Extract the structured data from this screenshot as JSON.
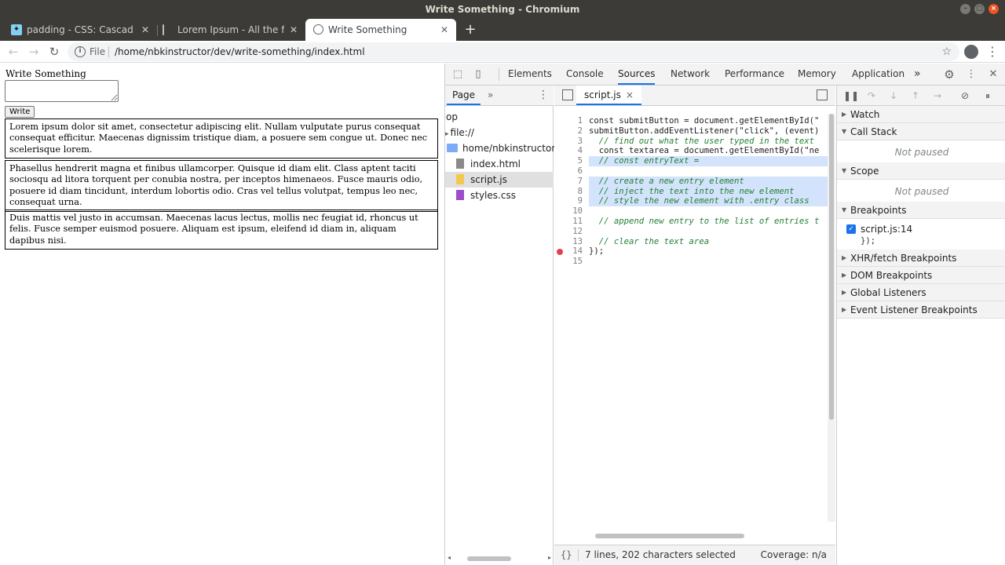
{
  "window": {
    "title": "Write Something - Chromium"
  },
  "tabs": [
    {
      "label": "padding - CSS: Cascading"
    },
    {
      "label": "Lorem Ipsum - All the fact"
    },
    {
      "label": "Write Something"
    }
  ],
  "toolbar": {
    "scheme": "File",
    "url": "/home/nbkinstructor/dev/write-something/index.html"
  },
  "page": {
    "heading": "Write Something",
    "write_button": "Write",
    "entries": [
      {
        "text": "Lorem ipsum dolor sit amet, consectetur adipiscing elit. Nullam vulputate purus consequat consequat efficitur. Maecenas dignissim tristique diam, a posuere sem congue ut. Donec nec scelerisque lorem."
      },
      {
        "text": "Phasellus hendrerit magna et finibus ullamcorper. Quisque id diam elit. Class aptent taciti sociosqu ad litora torquent per conubia nostra, per inceptos himenaeos. Fusce mauris odio, posuere id diam tincidunt, interdum lobortis odio. Cras vel tellus volutpat, tempus leo nec, consequat urna."
      },
      {
        "text": "Duis mattis vel justo in accumsan. Maecenas lacus lectus, mollis nec feugiat id, rhoncus ut felis. Fusce semper euismod posuere. Aliquam est ipsum, eleifend id diam in, aliquam dapibus nisi."
      }
    ]
  },
  "devtools": {
    "tabs": [
      {
        "label": "Elements"
      },
      {
        "label": "Console"
      },
      {
        "label": "Sources"
      },
      {
        "label": "Network"
      },
      {
        "label": "Performance"
      },
      {
        "label": "Memory"
      },
      {
        "label": "Application"
      }
    ],
    "more_tabs": "»",
    "navigator": {
      "tab": "Page",
      "more": "»",
      "items": [
        {
          "label": "op"
        },
        {
          "label": "file://"
        },
        {
          "label": "home/nbkinstructor/d"
        },
        {
          "label": "index.html"
        },
        {
          "label": "script.js"
        },
        {
          "label": "styles.css"
        }
      ]
    },
    "editor": {
      "file_tab": "script.js",
      "close": "×",
      "lines": [
        {
          "n": "1",
          "code": "const submitButton = document.getElementById(\""
        },
        {
          "n": "2",
          "code": "submitButton.addEventListener(\"click\", (event)"
        },
        {
          "n": "3",
          "code": "  // find out what the user typed in the text"
        },
        {
          "n": "4",
          "code": "  const textarea = document.getElementById(\"ne"
        },
        {
          "n": "5",
          "code": "  // const entryText ="
        },
        {
          "n": "6",
          "code": ""
        },
        {
          "n": "7",
          "code": "  // create a new entry element"
        },
        {
          "n": "8",
          "code": "  // inject the text into the new element"
        },
        {
          "n": "9",
          "code": "  // style the new element with .entry class"
        },
        {
          "n": "10",
          "code": ""
        },
        {
          "n": "11",
          "code": "  // append new entry to the list of entries t"
        },
        {
          "n": "12",
          "code": ""
        },
        {
          "n": "13",
          "code": "  // clear the text area"
        },
        {
          "n": "14",
          "code": "});"
        },
        {
          "n": "15",
          "code": ""
        }
      ]
    },
    "status": {
      "format": "{}",
      "selection": "7 lines, 202 characters selected",
      "coverage": "Coverage: n/a"
    },
    "debugger": {
      "watch": "Watch",
      "call_stack": "Call Stack",
      "call_stack_status": "Not paused",
      "scope": "Scope",
      "scope_status": "Not paused",
      "breakpoints": "Breakpoints",
      "breakpoint_label": "script.js:14",
      "breakpoint_code": "});",
      "xhr": "XHR/fetch Breakpoints",
      "dom": "DOM Breakpoints",
      "global": "Global Listeners",
      "event": "Event Listener Breakpoints"
    }
  },
  "colors": {
    "accent": "#1a73e8",
    "selection": "#d3e3fb",
    "comment": "#237f36",
    "breakpoint": "#e3404a",
    "ubuntu_chrome": "#3c3b37"
  }
}
